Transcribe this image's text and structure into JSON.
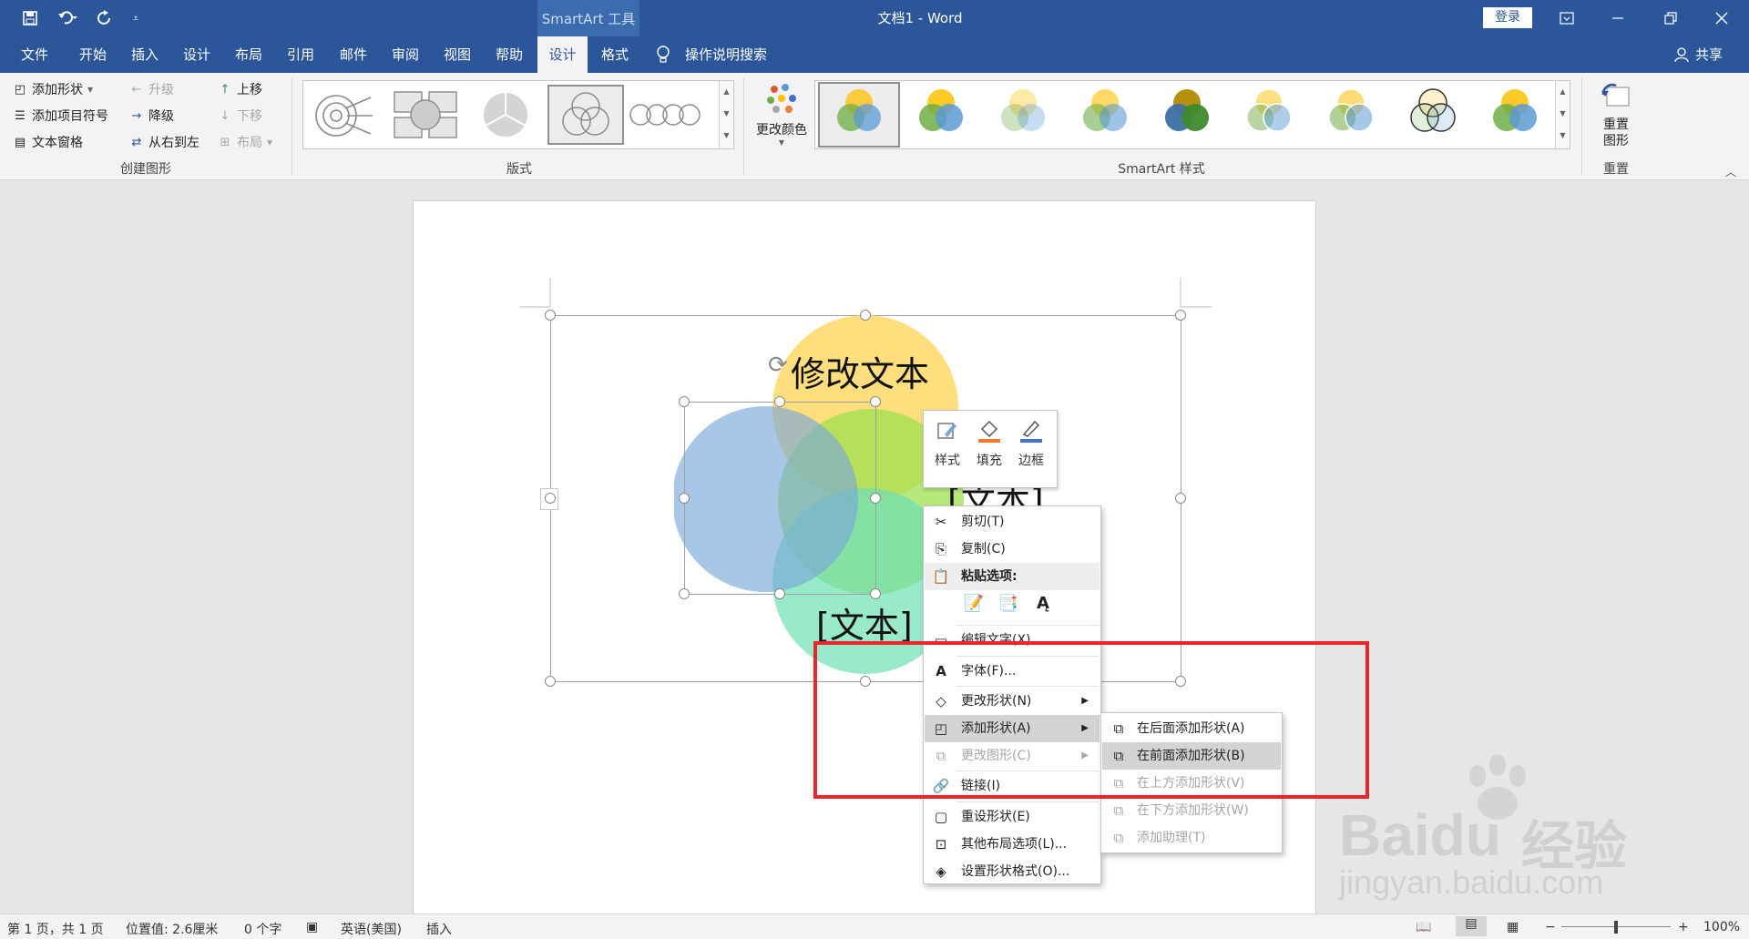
{
  "window": {
    "title": "文档1 - Word",
    "context_tools": "SmartArt 工具",
    "login": "登录"
  },
  "quick_access": {
    "icons": [
      "save-icon",
      "undo-icon",
      "redo-icon",
      "customize-icon"
    ]
  },
  "tabs": [
    "文件",
    "开始",
    "插入",
    "设计",
    "布局",
    "引用",
    "邮件",
    "审阅",
    "视图",
    "帮助",
    "设计",
    "格式"
  ],
  "tell_me": "操作说明搜索",
  "share": "共享",
  "ribbon": {
    "create": {
      "label": "创建图形",
      "add_shape": "添加形状",
      "add_bullet": "添加项目符号",
      "text_pane": "文本窗格",
      "promote": "升级",
      "demote": "降级",
      "rtl": "从右到左",
      "move_up": "上移",
      "move_down": "下移",
      "layout": "布局"
    },
    "layouts": {
      "label": "版式"
    },
    "styles": {
      "label": "SmartArt 样式",
      "change_colors": "更改颜色"
    },
    "reset": {
      "label": "重置",
      "reset_graphic": "重置图形"
    }
  },
  "smartart": {
    "top_text": "修改文本",
    "right_text": "[文本]",
    "bottom_text": "[文本]"
  },
  "mini_toolbar": {
    "style": "样式",
    "fill": "填充",
    "outline": "边框"
  },
  "context_menu": {
    "cut": "剪切(T)",
    "copy": "复制(C)",
    "paste_options": "粘贴选项:",
    "edit_text": "编辑文字(X)",
    "font": "字体(F)...",
    "change_shape": "更改形状(N)",
    "add_shape": "添加形状(A)",
    "change_graphic": "更改图形(C)",
    "link": "链接(I)",
    "reset_shape": "重设形状(E)",
    "more_layout": "其他布局选项(L)...",
    "format_shape": "设置形状格式(O)..."
  },
  "submenu": {
    "after": "在后面添加形状(A)",
    "before": "在前面添加形状(B)",
    "above": "在上方添加形状(V)",
    "below": "在下方添加形状(W)",
    "assistant": "添加助理(T)"
  },
  "status": {
    "page": "第 1 页，共 1 页",
    "position": "位置值: 2.6厘米",
    "words": "0 个字",
    "lang": "英语(美国)",
    "mode": "插入",
    "zoom": "100%"
  },
  "watermark": {
    "brand": "Baidu",
    "brand_cn": "经验",
    "url": "jingyan.baidu.com"
  }
}
